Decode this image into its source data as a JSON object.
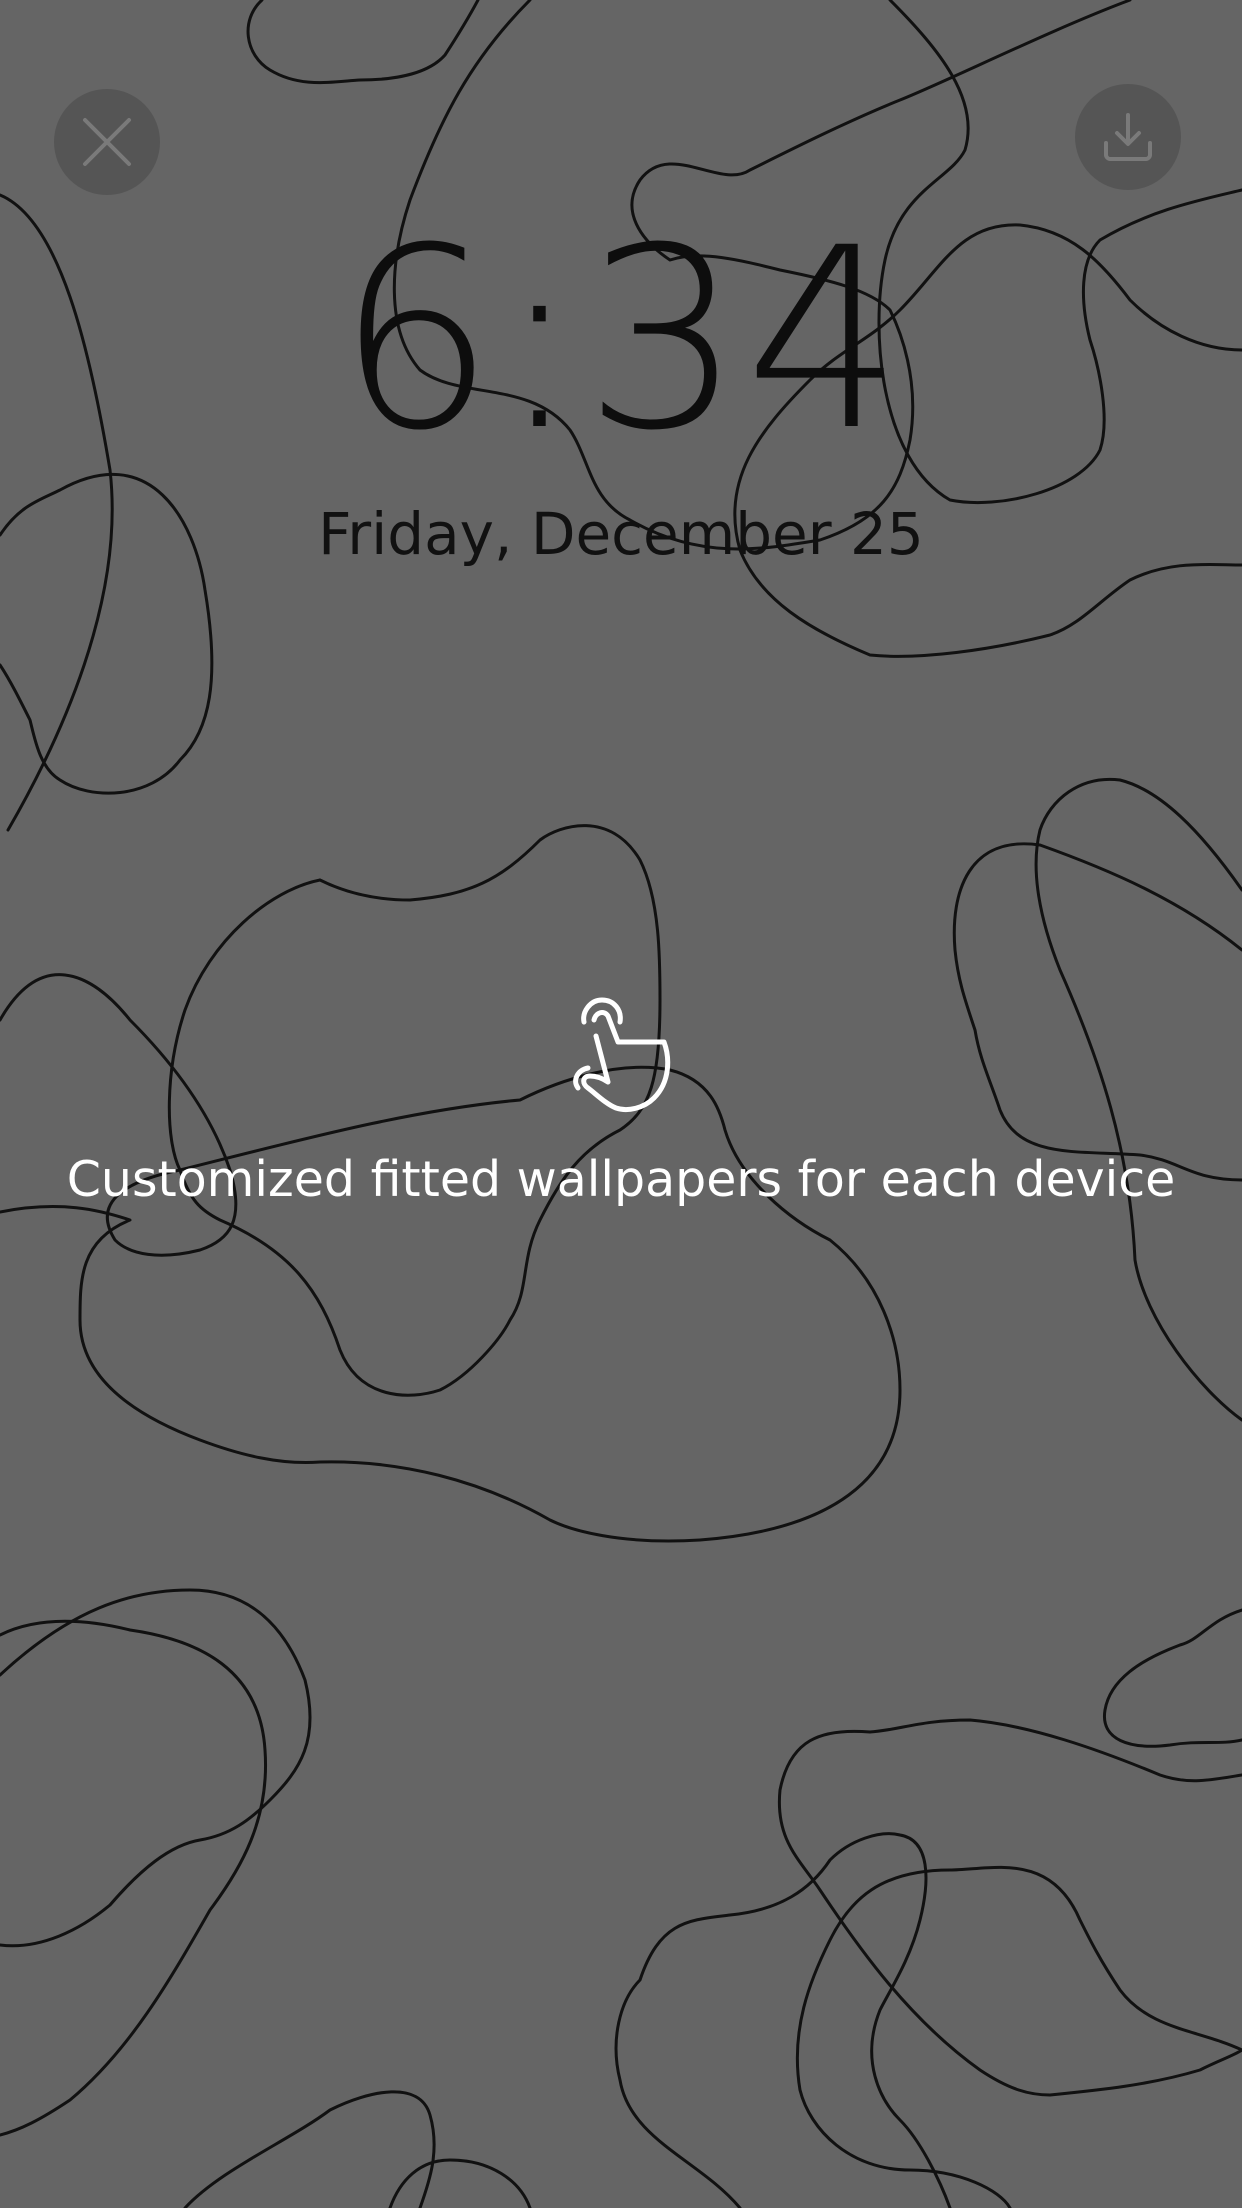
{
  "lockscreen": {
    "time": "6:34",
    "date": "Friday, December 25"
  },
  "controls": {
    "close_icon": "close-icon",
    "download_icon": "download-icon"
  },
  "hint": {
    "icon": "tap-hand-icon",
    "text": "Customized fitted wallpapers for each device"
  },
  "colors": {
    "background": "#656565",
    "line": "#111111",
    "button": "#555555",
    "hint_text": "#ffffff"
  }
}
